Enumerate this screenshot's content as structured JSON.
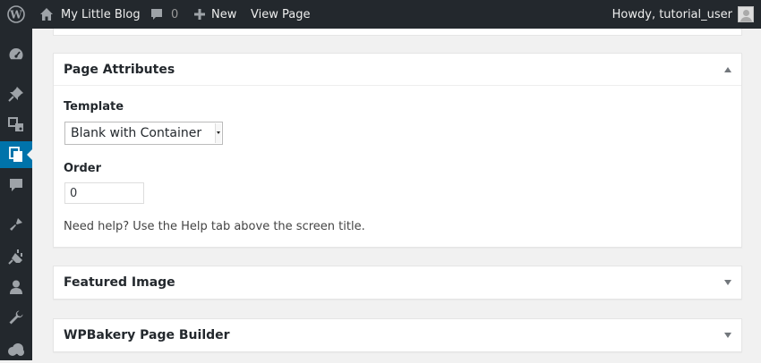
{
  "adminbar": {
    "site_name": "My Little Blog",
    "comment_count": "0",
    "new_label": "New",
    "view_page_label": "View Page",
    "howdy": "Howdy, tutorial_user"
  },
  "sidebar": {
    "icons": [
      "dashboard-icon",
      "posts-pin-icon",
      "media-icon",
      "pages-icon",
      "comments-icon",
      "appearance-brush-icon",
      "plugins-icon",
      "users-icon",
      "tools-wrench-icon",
      "vc-cloud-icon"
    ],
    "active": "pages-icon"
  },
  "page_attributes": {
    "title": "Page Attributes",
    "template_label": "Template",
    "template_value": "Blank with Container",
    "order_label": "Order",
    "order_value": "0",
    "help_text": "Need help? Use the Help tab above the screen title."
  },
  "featured_image": {
    "title": "Featured Image"
  },
  "wpbakery": {
    "title": "WPBakery Page Builder"
  },
  "colors": {
    "adminbar": "#23282d",
    "active": "#0073aa",
    "background": "#f1f1f1"
  }
}
